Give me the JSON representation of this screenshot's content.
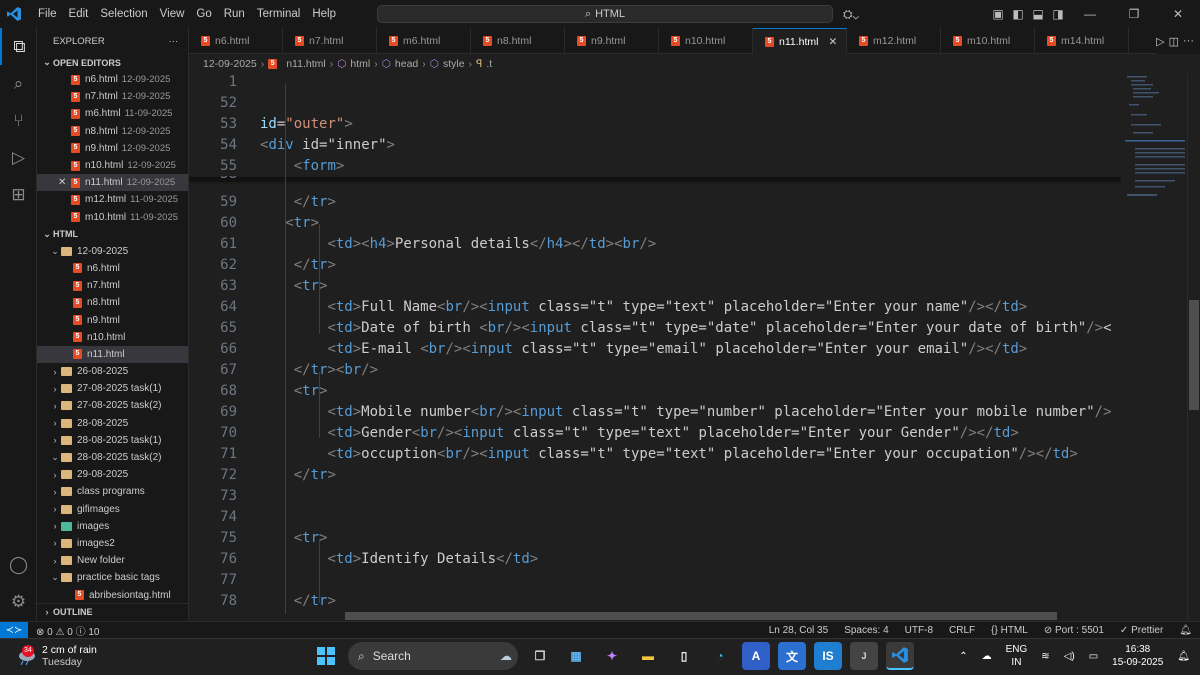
{
  "titlebar": {
    "menu": [
      "File",
      "Edit",
      "Selection",
      "View",
      "Go",
      "Run",
      "Terminal",
      "Help"
    ],
    "search": "HTML",
    "search_icon": "search-icon"
  },
  "sidebar": {
    "title": "EXPLORER",
    "more": "···",
    "open_editors_label": "OPEN EDITORS",
    "open_editors": [
      {
        "name": "n6.html",
        "date": "12-09-2025"
      },
      {
        "name": "n7.html",
        "date": "12-09-2025"
      },
      {
        "name": "m6.html",
        "date": "11-09-2025"
      },
      {
        "name": "n8.html",
        "date": "12-09-2025"
      },
      {
        "name": "n9.html",
        "date": "12-09-2025"
      },
      {
        "name": "n10.html",
        "date": "12-09-2025"
      },
      {
        "name": "n11.html",
        "date": "12-09-2025"
      },
      {
        "name": "m12.html",
        "date": "11-09-2025"
      },
      {
        "name": "m10.html",
        "date": "11-09-2025"
      }
    ],
    "folder_label": "HTML",
    "subfolder": "12-09-2025",
    "subfiles": [
      "n6.html",
      "n7.html",
      "n8.html",
      "n9.html",
      "n10.html",
      "n11.html"
    ],
    "folders": [
      "26-08-2025",
      "27-08-2025 task(1)",
      "27-08-2025 task(2)",
      "28-08-2025",
      "28-08-2025 task(1)",
      "28-08-2025 task(2)",
      "29-08-2025",
      "class programs",
      "gifimages",
      "images",
      "images2",
      "New folder",
      "practice basic tags"
    ],
    "practice_file": "abribesiontag.html",
    "outline_label": "OUTLINE"
  },
  "tabs": [
    "n6.html",
    "n7.html",
    "m6.html",
    "n8.html",
    "n9.html",
    "n10.html",
    "n11.html",
    "m12.html",
    "m10.html",
    "m14.html"
  ],
  "active_tab": "n11.html",
  "breadcrumb": [
    "12-09-2025",
    "n11.html",
    "html",
    "head",
    "style",
    ".t"
  ],
  "editor": {
    "sticky": [
      {
        "n": "1",
        "code": ""
      },
      {
        "n": "52",
        "code": ""
      },
      {
        "n": "53",
        "code": "id=\"outer\">"
      },
      {
        "n": "54",
        "code": "<div id=\"inner\">"
      },
      {
        "n": "55",
        "code": "    <form>"
      }
    ],
    "partial_line": "58",
    "lines": [
      {
        "n": "59",
        "code": "    </tr>"
      },
      {
        "n": "60",
        "code": "   <tr>"
      },
      {
        "n": "61",
        "code": "        <td><h4>Personal details</h4></td><br/>"
      },
      {
        "n": "62",
        "code": "    </tr>"
      },
      {
        "n": "63",
        "code": "    <tr>"
      },
      {
        "n": "64",
        "code": "        <td>Full Name<br/><input class=\"t\" type=\"text\" placeholder=\"Enter your name\"/></td>"
      },
      {
        "n": "65",
        "code": "        <td>Date of birth <br/><input class=\"t\" type=\"date\" placeholder=\"Enter your date of birth\"/><"
      },
      {
        "n": "66",
        "code": "        <td>E-mail <br/><input class=\"t\" type=\"email\" placeholder=\"Enter your email\"/></td>"
      },
      {
        "n": "67",
        "code": "    </tr><br/>"
      },
      {
        "n": "68",
        "code": "    <tr>"
      },
      {
        "n": "69",
        "code": "        <td>Mobile number<br/><input class=\"t\" type=\"number\" placeholder=\"Enter your mobile number\"/>"
      },
      {
        "n": "70",
        "code": "        <td>Gender<br/><input class=\"t\" type=\"text\" placeholder=\"Enter your Gender\"/></td>"
      },
      {
        "n": "71",
        "code": "        <td>occuption<br/><input class=\"t\" type=\"text\" placeholder=\"Enter your occupation\"/></td>"
      },
      {
        "n": "72",
        "code": "    </tr>"
      },
      {
        "n": "73",
        "code": ""
      },
      {
        "n": "74",
        "code": ""
      },
      {
        "n": "75",
        "code": "    <tr>"
      },
      {
        "n": "76",
        "code": "        <td>Identify Details</td>"
      },
      {
        "n": "77",
        "code": ""
      },
      {
        "n": "78",
        "code": "    </tr>"
      }
    ]
  },
  "statusbar": {
    "problems": "⊗ 0 ⚠ 0 ⓘ 10",
    "position": "Ln 28, Col 35",
    "spaces": "Spaces: 4",
    "encoding": "UTF-8",
    "eol": "CRLF",
    "language": "{} HTML",
    "port": "⊘ Port : 5501",
    "prettier": "✓ Prettier"
  },
  "taskbar": {
    "weather_badge": "34",
    "weather_line1": "2 cm of rain",
    "weather_line2": "Tuesday",
    "search": "Search",
    "lang1": "ENG",
    "lang2": "IN",
    "time": "16:38",
    "date": "15-09-2025"
  },
  "colors": {
    "accent": "#0078d4",
    "html_icon": "#e34c26",
    "folder": "#dcb67a"
  }
}
